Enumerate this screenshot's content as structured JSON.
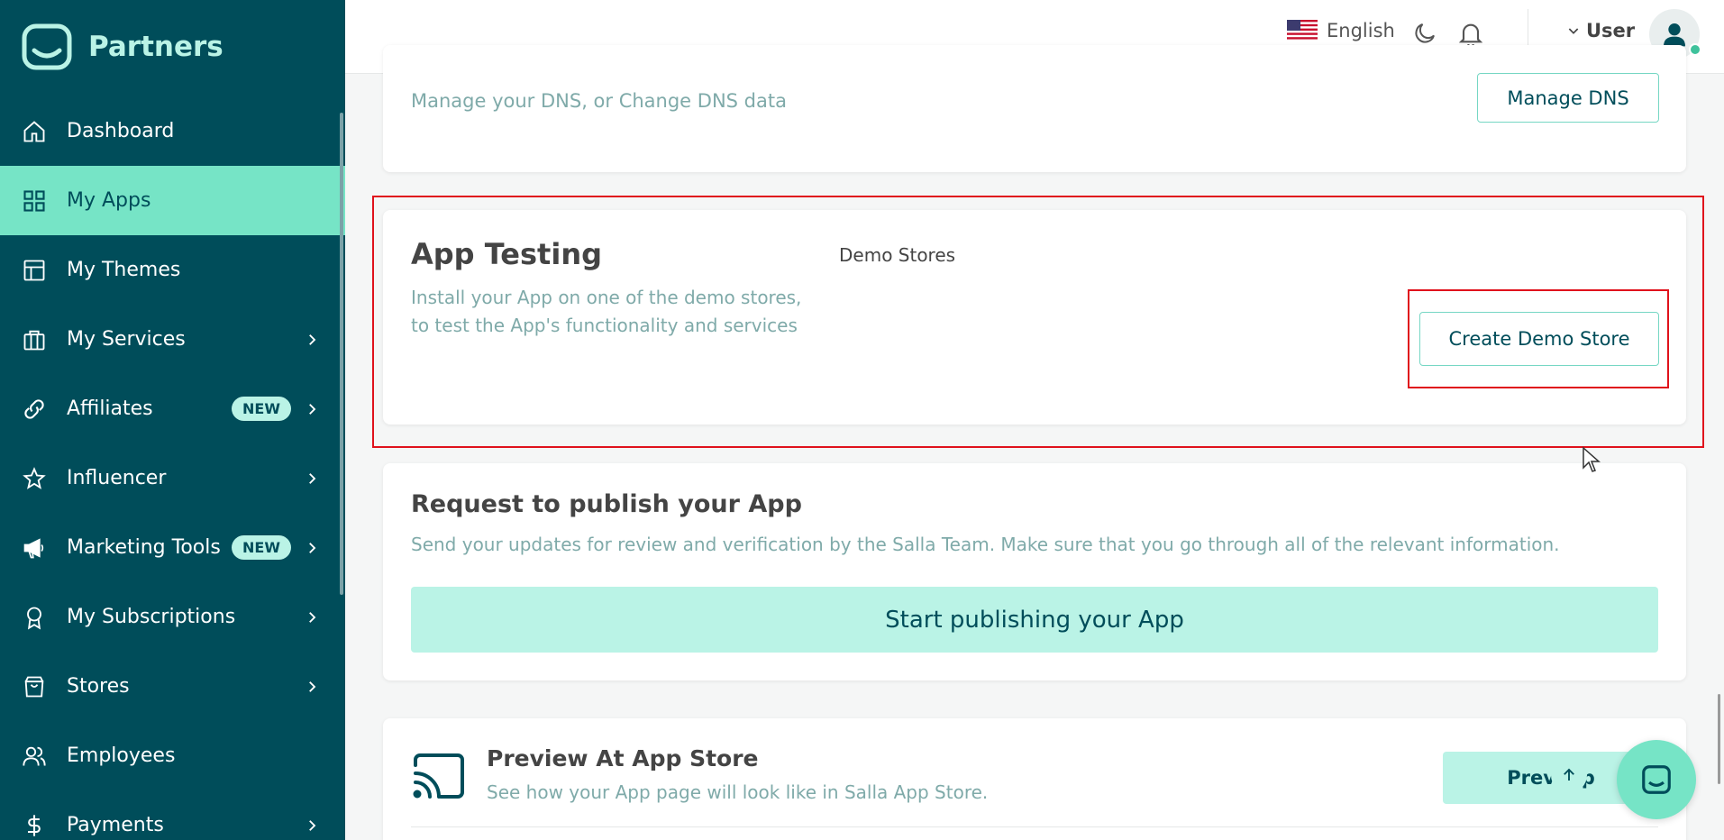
{
  "brand": {
    "name": "Partners"
  },
  "sidebar": {
    "items": [
      {
        "label": "Dashboard",
        "icon": "home-icon",
        "active": false,
        "badge": "",
        "chevron": false
      },
      {
        "label": "My Apps",
        "icon": "grid-icon",
        "active": true,
        "badge": "",
        "chevron": false
      },
      {
        "label": "My Themes",
        "icon": "layout-icon",
        "active": false,
        "badge": "",
        "chevron": false
      },
      {
        "label": "My Services",
        "icon": "briefcase-icon",
        "active": false,
        "badge": "",
        "chevron": true
      },
      {
        "label": "Affiliates",
        "icon": "link-icon",
        "active": false,
        "badge": "NEW",
        "chevron": true
      },
      {
        "label": "Influencer",
        "icon": "star-icon",
        "active": false,
        "badge": "",
        "chevron": true
      },
      {
        "label": "Marketing Tools",
        "icon": "megaphone-icon",
        "active": false,
        "badge": "NEW",
        "chevron": true
      },
      {
        "label": "My Subscriptions",
        "icon": "award-icon",
        "active": false,
        "badge": "",
        "chevron": true
      },
      {
        "label": "Stores",
        "icon": "shopping-bag-icon",
        "active": false,
        "badge": "",
        "chevron": true
      },
      {
        "label": "Employees",
        "icon": "users-icon",
        "active": false,
        "badge": "",
        "chevron": false
      },
      {
        "label": "Payments",
        "icon": "dollar-icon",
        "active": false,
        "badge": "",
        "chevron": true
      }
    ]
  },
  "topbar": {
    "language": "English",
    "user_label": "User"
  },
  "dns_card": {
    "description": "Manage your DNS, or Change DNS data",
    "button_label": "Manage DNS"
  },
  "testing_card": {
    "title": "App Testing",
    "description": "Install your App on one of the demo stores, to test the App's functionality and services",
    "stores_label": "Demo Stores",
    "button_label": "Create Demo Store"
  },
  "publish_card": {
    "title": "Request to publish your App",
    "description": "Send your updates for review and verification by the Salla Team. Make sure that you go through all of the relevant information.",
    "button_label": "Start publishing your App"
  },
  "preview_card": {
    "title": "Preview At App Store",
    "description": "See how your App page will look like in Salla App Store.",
    "button_label": "Previe    p"
  },
  "colors": {
    "sidebar_bg": "#004d5a",
    "accent": "#76e4c6",
    "accent_light": "#baf3e6",
    "highlight": "#e0121c"
  }
}
